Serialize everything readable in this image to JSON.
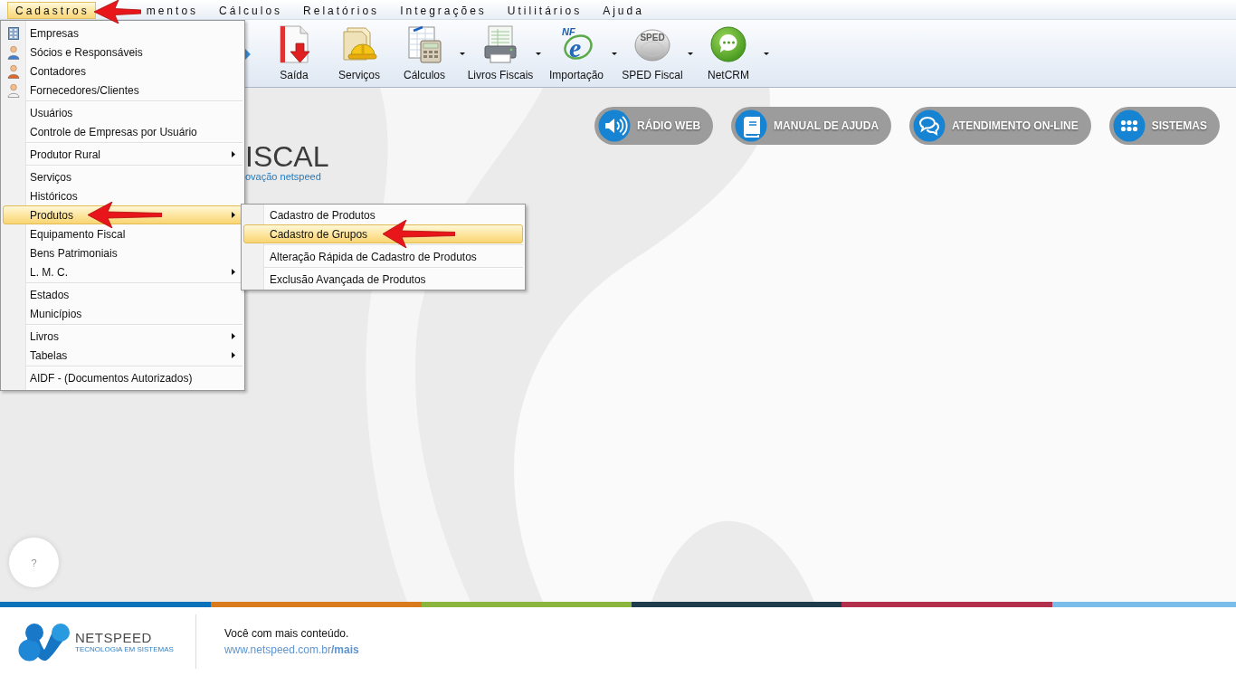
{
  "menu_bar": {
    "items": [
      {
        "label": "Cadastros",
        "selected": true
      },
      {
        "label": "mentos",
        "selected": false
      },
      {
        "label": "Cálculos",
        "selected": false
      },
      {
        "label": "Relatórios",
        "selected": false
      },
      {
        "label": "Integrações",
        "selected": false
      },
      {
        "label": "Utilitários",
        "selected": false
      },
      {
        "label": "Ajuda",
        "selected": false
      }
    ]
  },
  "cadastros_menu": {
    "groups": [
      {
        "items": [
          {
            "label": "Empresas",
            "kind": "icon",
            "selected": false,
            "submenu": false
          },
          {
            "label": "Sócios e Responsáveis",
            "kind": "icon",
            "selected": false,
            "submenu": false
          },
          {
            "label": "Contadores",
            "kind": "icon",
            "selected": false,
            "submenu": false
          },
          {
            "label": "Fornecedores/Clientes",
            "kind": "icon",
            "selected": false,
            "submenu": false
          }
        ]
      },
      {
        "items": [
          {
            "label": "Usuários",
            "kind": "text",
            "selected": false,
            "submenu": false
          },
          {
            "label": "Controle de Empresas por Usuário",
            "kind": "text",
            "selected": false,
            "submenu": false
          }
        ]
      },
      {
        "items": [
          {
            "label": "Produtor Rural",
            "kind": "text",
            "selected": false,
            "submenu": true
          }
        ]
      },
      {
        "items": [
          {
            "label": "Serviços",
            "kind": "text",
            "selected": false,
            "submenu": false
          },
          {
            "label": "Históricos",
            "kind": "text",
            "selected": false,
            "submenu": false
          },
          {
            "label": "Produtos",
            "kind": "text",
            "selected": true,
            "submenu": true
          },
          {
            "label": "Equipamento Fiscal",
            "kind": "text",
            "selected": false,
            "submenu": false
          },
          {
            "label": "Bens Patrimoniais",
            "kind": "text",
            "selected": false,
            "submenu": false
          },
          {
            "label": "L. M. C.",
            "kind": "text",
            "selected": false,
            "submenu": true
          }
        ]
      },
      {
        "items": [
          {
            "label": "Estados",
            "kind": "text",
            "selected": false,
            "submenu": false
          },
          {
            "label": "Municípios",
            "kind": "text",
            "selected": false,
            "submenu": false
          }
        ]
      },
      {
        "items": [
          {
            "label": "Livros",
            "kind": "text",
            "selected": false,
            "submenu": true
          },
          {
            "label": "Tabelas",
            "kind": "text",
            "selected": false,
            "submenu": true
          }
        ]
      },
      {
        "items": [
          {
            "label": "AIDF - (Documentos Autorizados)",
            "kind": "text",
            "selected": false,
            "submenu": false
          }
        ]
      }
    ]
  },
  "produtos_submenu": {
    "groups": [
      {
        "items": [
          {
            "label": "Cadastro de Produtos",
            "selected": false
          },
          {
            "label": "Cadastro de Grupos",
            "selected": true
          }
        ]
      },
      {
        "items": [
          {
            "label": "Alteração Rápida de Cadastro de Produtos",
            "selected": false
          }
        ]
      },
      {
        "items": [
          {
            "label": "Exclusão Avançada de Produtos",
            "selected": false
          }
        ]
      }
    ]
  },
  "toolbar": {
    "items": [
      {
        "label": "Saída",
        "dropdown": false
      },
      {
        "label": "Serviços",
        "dropdown": false
      },
      {
        "label": "Cálculos",
        "dropdown": true
      },
      {
        "label": "Livros Fiscais",
        "dropdown": true
      },
      {
        "label": "Importação",
        "icon_texts": [
          "NF",
          "e"
        ],
        "dropdown": true
      },
      {
        "label": "SPED Fiscal",
        "icon_texts": [
          "SPED"
        ],
        "dropdown": true
      },
      {
        "label": "NetCRM",
        "dropdown": true
      }
    ]
  },
  "quick_links": [
    {
      "label": "RÁDIO WEB"
    },
    {
      "label": "MANUAL DE AJUDA"
    },
    {
      "label": "ATENDIMENTO ON-LINE"
    },
    {
      "label": "SISTEMAS"
    }
  ],
  "logo": {
    "title": "ISCAL",
    "tagline": "ovação netspeed"
  },
  "help_button": {
    "label": "?"
  },
  "footer": {
    "brand": "NETSPEED",
    "brand_tagline": "TECNOLOGIA EM SISTEMAS",
    "message": "Você com mais conteúdo.",
    "link": "www.netspeed.com.br**/mais**"
  }
}
